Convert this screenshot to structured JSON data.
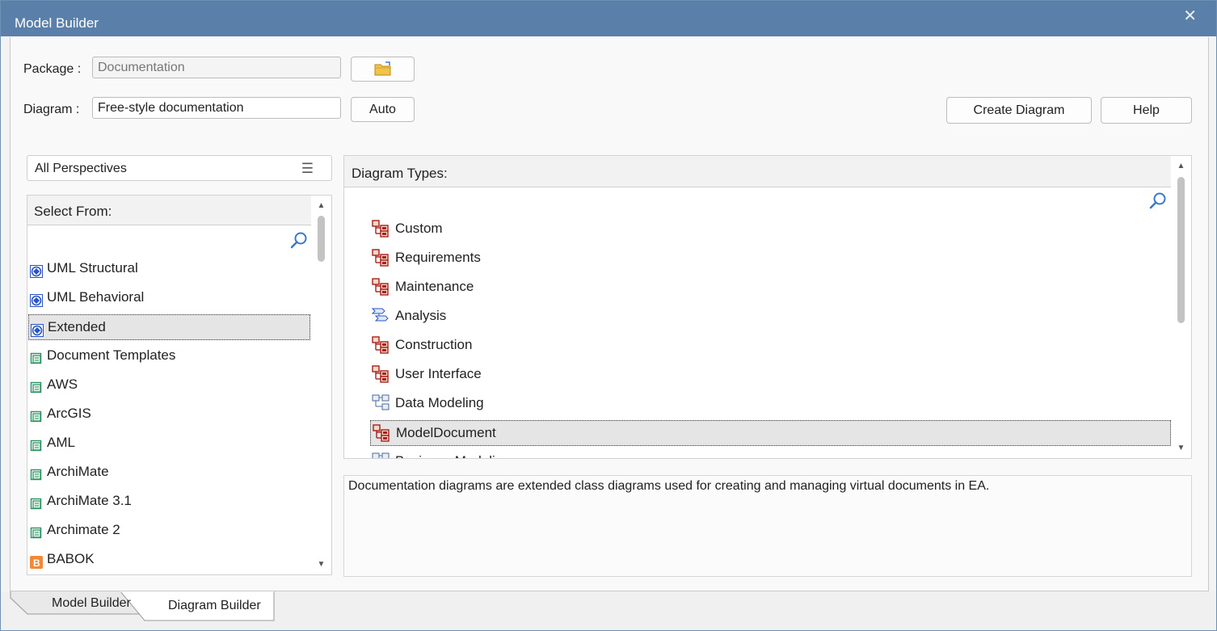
{
  "window": {
    "title": "Model Builder",
    "close_glyph": "✕"
  },
  "form": {
    "package_label": "Package :",
    "package_value": "Documentation",
    "diagram_label": "Diagram :",
    "diagram_value": "Free-style documentation",
    "auto_button": "Auto",
    "create_button": "Create Diagram",
    "help_button": "Help"
  },
  "perspectives": {
    "selected": "All Perspectives"
  },
  "select_from": {
    "header": "Select From:",
    "items": [
      {
        "label": "UML Structural",
        "icon": "uml-icon"
      },
      {
        "label": "UML Behavioral",
        "icon": "uml-icon"
      },
      {
        "label": "Extended",
        "icon": "uml-icon",
        "selected": true
      },
      {
        "label": "Document Templates",
        "icon": "technology-icon"
      },
      {
        "label": "AWS",
        "icon": "technology-icon"
      },
      {
        "label": "ArcGIS",
        "icon": "technology-icon"
      },
      {
        "label": "AML",
        "icon": "technology-icon"
      },
      {
        "label": "ArchiMate",
        "icon": "technology-icon"
      },
      {
        "label": "ArchiMate 3.1",
        "icon": "technology-icon"
      },
      {
        "label": "Archimate 2",
        "icon": "technology-icon"
      },
      {
        "label": "BABOK",
        "icon": "babok-icon"
      }
    ]
  },
  "diagram_types": {
    "header": "Diagram Types:",
    "items": [
      {
        "label": "Custom",
        "icon": "custom-diagram-icon"
      },
      {
        "label": "Requirements",
        "icon": "custom-diagram-icon"
      },
      {
        "label": "Maintenance",
        "icon": "custom-diagram-icon"
      },
      {
        "label": "Analysis",
        "icon": "analysis-diagram-icon"
      },
      {
        "label": "Construction",
        "icon": "custom-diagram-icon"
      },
      {
        "label": "User Interface",
        "icon": "custom-diagram-icon"
      },
      {
        "label": "Data Modeling",
        "icon": "data-model-icon"
      },
      {
        "label": "ModelDocument",
        "icon": "custom-diagram-icon",
        "selected": true
      },
      {
        "label": "Business Modeling",
        "icon": "data-model-icon",
        "partial": true
      }
    ]
  },
  "description": "Documentation diagrams are extended class diagrams used for creating and managing virtual documents in EA.",
  "tabs": [
    {
      "label": "Model Builder",
      "active": false
    },
    {
      "label": "Diagram Builder",
      "active": true
    }
  ],
  "colors": {
    "titlebar": "#5a7fa8",
    "selection": "#e5e5e5",
    "icon_red": "#a8201a",
    "icon_blue": "#2a55c8",
    "icon_green": "#2a9060"
  }
}
